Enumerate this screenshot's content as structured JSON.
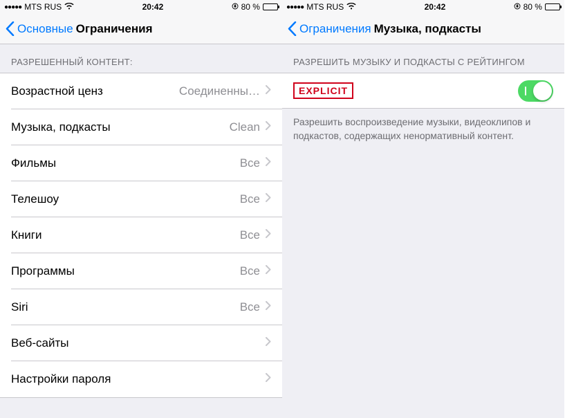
{
  "status": {
    "carrier": "MTS RUS",
    "time": "20:42",
    "battery_pct": "80 %"
  },
  "left": {
    "back_label": "Основные",
    "title": "Ограничения",
    "section_header": "РАЗРЕШЕННЫЙ КОНТЕНТ:",
    "rows": [
      {
        "label": "Возрастной ценз",
        "value": "Соединенны…"
      },
      {
        "label": "Музыка, подкасты",
        "value": "Clean"
      },
      {
        "label": "Фильмы",
        "value": "Все"
      },
      {
        "label": "Телешоу",
        "value": "Все"
      },
      {
        "label": "Книги",
        "value": "Все"
      },
      {
        "label": "Программы",
        "value": "Все"
      },
      {
        "label": "Siri",
        "value": "Все"
      },
      {
        "label": "Веб-сайты",
        "value": ""
      },
      {
        "label": "Настройки пароля",
        "value": ""
      }
    ]
  },
  "right": {
    "back_label": "Ограничения",
    "title": "Музыка, подкасты",
    "section_header": "РАЗРЕШИТЬ МУЗЫКУ И ПОДКАСТЫ С РЕЙТИНГОМ",
    "explicit_label": "EXPLICIT",
    "toggle_on": true,
    "footer": "Разрешить воспроизведение музыки, видеоклипов и подкастов, содержащих ненормативный контент."
  }
}
